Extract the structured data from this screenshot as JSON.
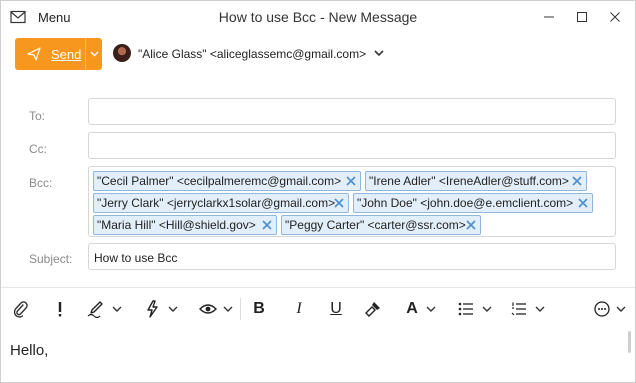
{
  "window": {
    "title": "How to use Bcc - New Message",
    "menu_label": "Menu"
  },
  "compose": {
    "send_label": "Send",
    "from": "\"Alice Glass\" <aliceglassemc@gmail.com>",
    "to_label": "To:",
    "cc_label": "Cc:",
    "bcc_label": "Bcc:",
    "subject_label": "Subject:",
    "to_value": "",
    "cc_value": "",
    "subject_value": "How to use Bcc",
    "bcc_recipients": [
      "\"Cecil Palmer\" <cecilpalmeremc@gmail.com>",
      "\"Irene Adler\" <IreneAdler@stuff.com>",
      "\"Jerry Clark\" <jerryclarkx1solar@gmail.com>",
      "\"John Doe\" <john.doe@e.emclient.com>",
      "\"Maria Hill\" <Hill@shield.gov>",
      "\"Peggy Carter\" <carter@ssr.com>"
    ]
  },
  "toolbar": {
    "icons": [
      "attach-icon",
      "priority-icon",
      "signature-icon",
      "quick-text-icon",
      "view-icon",
      "bold-icon",
      "italic-icon",
      "underline-icon",
      "format-painter-icon",
      "font-color-icon",
      "bullet-list-icon",
      "numbered-list-icon",
      "more-icon"
    ],
    "bold": "B",
    "italic": "I",
    "underline": "U",
    "font": "A"
  },
  "body": {
    "text": "Hello,"
  },
  "colors": {
    "send": "#f7971e",
    "chip_bg": "#e2eef9",
    "chip_border": "#8fb8dc",
    "chip_x": "#4a8fd1"
  }
}
